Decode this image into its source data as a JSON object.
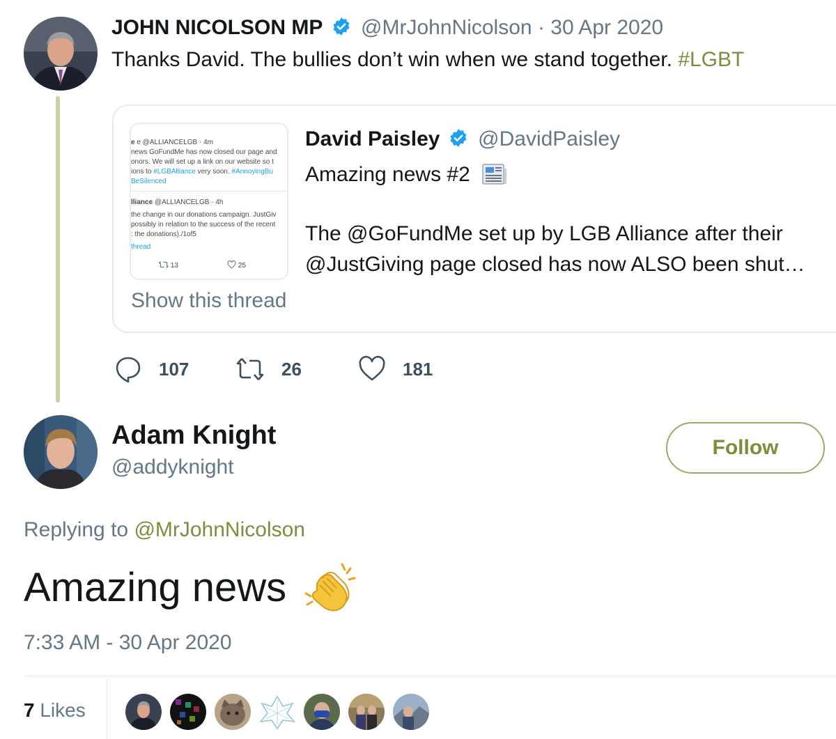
{
  "tweet1": {
    "name": "JOHN NICOLSON MP",
    "handle": "@MrJohnNicolson",
    "date": "· 30 Apr 2020",
    "text": "Thanks David. The bullies don’t win when we stand together.",
    "hashtag": "#LGBT",
    "avatar_icon": "man-in-suit-avatar"
  },
  "quote": {
    "name": "David Paisley",
    "handle": "@DavidPaisley",
    "line1": "Amazing news #2",
    "line1_emoji": "newspaper-icon",
    "line2": "The @GoFundMe set up by LGB Alliance after their",
    "line3": "@JustGiving page closed has now ALSO been shut…",
    "show_thread": "Show this thread",
    "thumbnail": {
      "tweet_a": {
        "header": "e @ALLIANCELGB · 4m",
        "l1": "news GoFundMe has now closed our page and",
        "l2": "onors.  We will set up a link on our website so t",
        "l3_pre": "ions to ",
        "l3_tag": "#LGBAlliance",
        "l3_mid": " very soon. ",
        "l3_tag2": "#AnnoyingBu",
        "l4": "BeSilenced"
      },
      "tweet_b": {
        "header_bold": "lliance",
        "header": " @ALLIANCELGB · 4h",
        "l1": "the change in our donations campaign. JustGiv",
        "l2": "possibly in relation to the success of the recent",
        "l3": ": the donations)./1of5",
        "l4": "thread",
        "retweets": "13",
        "likes": "25"
      }
    }
  },
  "actions": {
    "replies": "107",
    "retweets": "26",
    "likes": "181"
  },
  "reply_tweet": {
    "name": "Adam Knight",
    "handle": "@addyknight",
    "follow_label": "Follow",
    "replying_prefix": "Replying to",
    "replying_handle": "@MrJohnNicolson",
    "text": "Amazing news",
    "text_emoji": "clapping-hands-icon",
    "timestamp": "7:33 AM - 30 Apr 2020",
    "likes_count": "7",
    "likes_label": "Likes"
  },
  "colors": {
    "accent": "#7a8f3c",
    "verified": "#1da1f2",
    "muted": "#657786",
    "thread_line": "#c9d3a5"
  }
}
